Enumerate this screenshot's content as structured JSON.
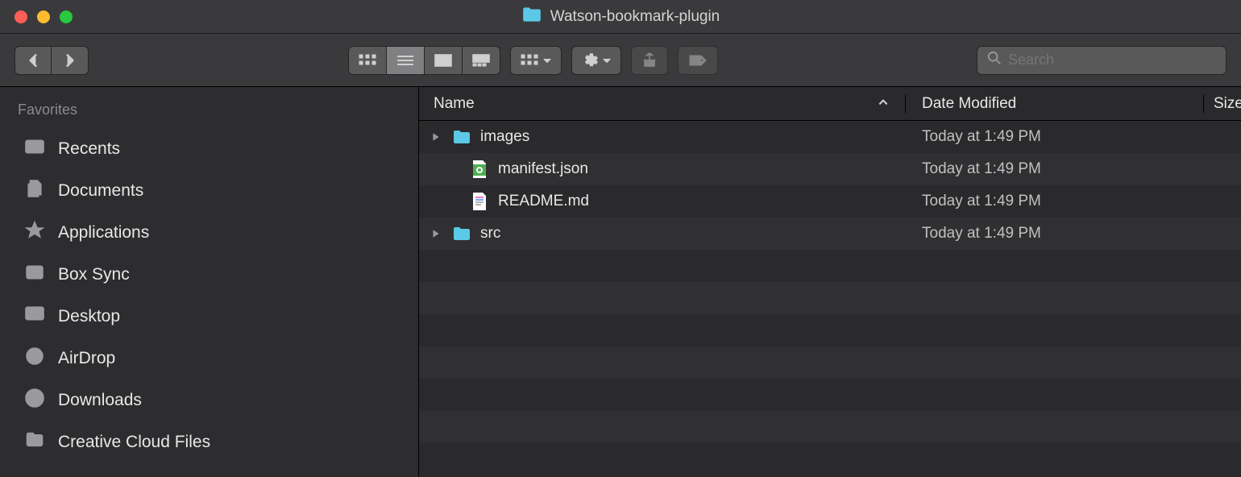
{
  "window": {
    "title": "Watson-bookmark-plugin"
  },
  "search": {
    "placeholder": "Search"
  },
  "sidebar": {
    "section_label": "Favorites",
    "items": [
      {
        "label": "Recents",
        "icon": "clock-folder-icon"
      },
      {
        "label": "Documents",
        "icon": "documents-icon"
      },
      {
        "label": "Applications",
        "icon": "applications-icon"
      },
      {
        "label": "Box Sync",
        "icon": "box-icon"
      },
      {
        "label": "Desktop",
        "icon": "desktop-icon"
      },
      {
        "label": "AirDrop",
        "icon": "airdrop-icon"
      },
      {
        "label": "Downloads",
        "icon": "downloads-icon"
      },
      {
        "label": "Creative Cloud Files",
        "icon": "folder-icon"
      }
    ]
  },
  "columns": {
    "name": "Name",
    "date": "Date Modified",
    "size": "Size"
  },
  "files": [
    {
      "name": "images",
      "type": "folder",
      "date": "Today at 1:49 PM"
    },
    {
      "name": "manifest.json",
      "type": "json",
      "date": "Today at 1:49 PM"
    },
    {
      "name": "README.md",
      "type": "md",
      "date": "Today at 1:49 PM"
    },
    {
      "name": "src",
      "type": "folder",
      "date": "Today at 1:49 PM"
    }
  ]
}
